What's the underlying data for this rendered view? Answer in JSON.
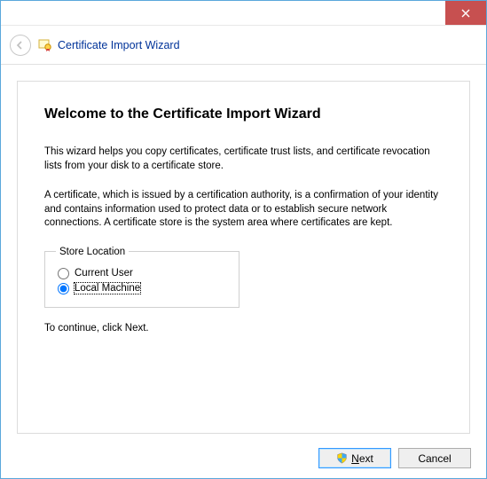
{
  "titlebar": {},
  "header": {
    "title": "Certificate Import Wizard"
  },
  "content": {
    "welcome_heading": "Welcome to the Certificate Import Wizard",
    "intro_para": "This wizard helps you copy certificates, certificate trust lists, and certificate revocation lists from your disk to a certificate store.",
    "desc_para": "A certificate, which is issued by a certification authority, is a confirmation of your identity and contains information used to protect data or to establish secure network connections. A certificate store is the system area where certificates are kept.",
    "store_legend": "Store Location",
    "radio_current_user": "Current User",
    "radio_local_machine": "Local Machine",
    "continue_text": "To continue, click Next."
  },
  "footer": {
    "next_prefix": "N",
    "next_rest": "ext",
    "cancel_label": "Cancel"
  }
}
